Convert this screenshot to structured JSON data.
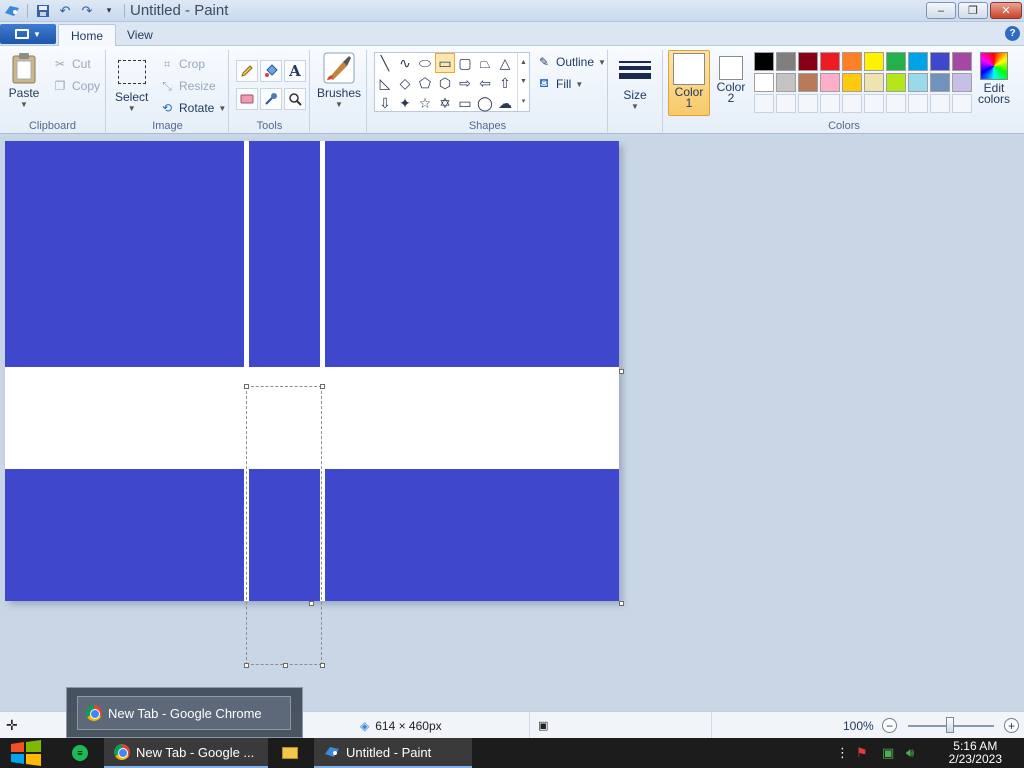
{
  "window": {
    "title": "Untitled - Paint"
  },
  "tabs": [
    {
      "label": "Home"
    },
    {
      "label": "View"
    }
  ],
  "clipboard": {
    "paste": "Paste",
    "cut": "Cut",
    "copy": "Copy",
    "group": "Clipboard"
  },
  "image": {
    "select": "Select",
    "crop": "Crop",
    "resize": "Resize",
    "rotate": "Rotate",
    "group": "Image"
  },
  "tools": {
    "group": "Tools"
  },
  "brushes": {
    "label": "Brushes"
  },
  "shapes": {
    "outline": "Outline",
    "fill": "Fill",
    "group": "Shapes"
  },
  "size": {
    "label": "Size"
  },
  "colors": {
    "color1": "Color 1",
    "color2": "Color 2",
    "edit": "Edit colors",
    "group": "Colors",
    "palette_row1": [
      "#000000",
      "#7f7f7f",
      "#880015",
      "#ed1c24",
      "#ff7f27",
      "#fff200",
      "#22b14c",
      "#00a2e8",
      "#3f48cc",
      "#a349a4"
    ],
    "palette_row2": [
      "#ffffff",
      "#c3c3c3",
      "#b97a57",
      "#ffaec9",
      "#ffc90e",
      "#efe4b0",
      "#b5e61d",
      "#99d9ea",
      "#7092be",
      "#c8bfe7"
    ]
  },
  "canvas": {
    "fill_color": "#3f48cc"
  },
  "status": {
    "dimensions": "614 × 460px",
    "zoom": "100%"
  },
  "thumbnail": {
    "label": "New Tab - Google Chrome"
  },
  "taskbar": {
    "chrome": "New Tab - Google ...",
    "paint": "Untitled - Paint",
    "time": "5:16 AM",
    "date": "2/23/2023"
  }
}
